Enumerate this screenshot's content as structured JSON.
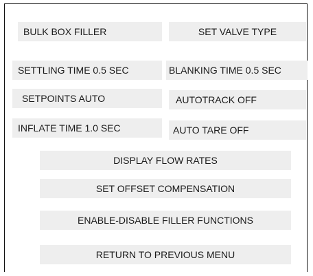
{
  "menu": {
    "bulk_box_filler": "BULK BOX FILLER",
    "set_valve_type": "SET VALVE TYPE",
    "settling_time": "SETTLING TIME  0.5 SEC",
    "blanking_time": "BLANKING TIME 0.5 SEC",
    "setpoints": "SETPOINTS  AUTO",
    "autotrack": "AUTOTRACK  OFF",
    "inflate_time": "INFLATE TIME   1.0 SEC",
    "auto_tare": "AUTO TARE  OFF",
    "display_flow_rates": "DISPLAY FLOW RATES",
    "set_offset_compensation": "SET OFFSET COMPENSATION",
    "enable_disable_filler_functions": "ENABLE-DISABLE FILLER FUNCTIONS",
    "return_to_previous_menu": "RETURN TO PREVIOUS MENU"
  },
  "colors": {
    "button_bg": "#eeeeee",
    "text": "#1a1a1a",
    "frame": "#111111"
  }
}
